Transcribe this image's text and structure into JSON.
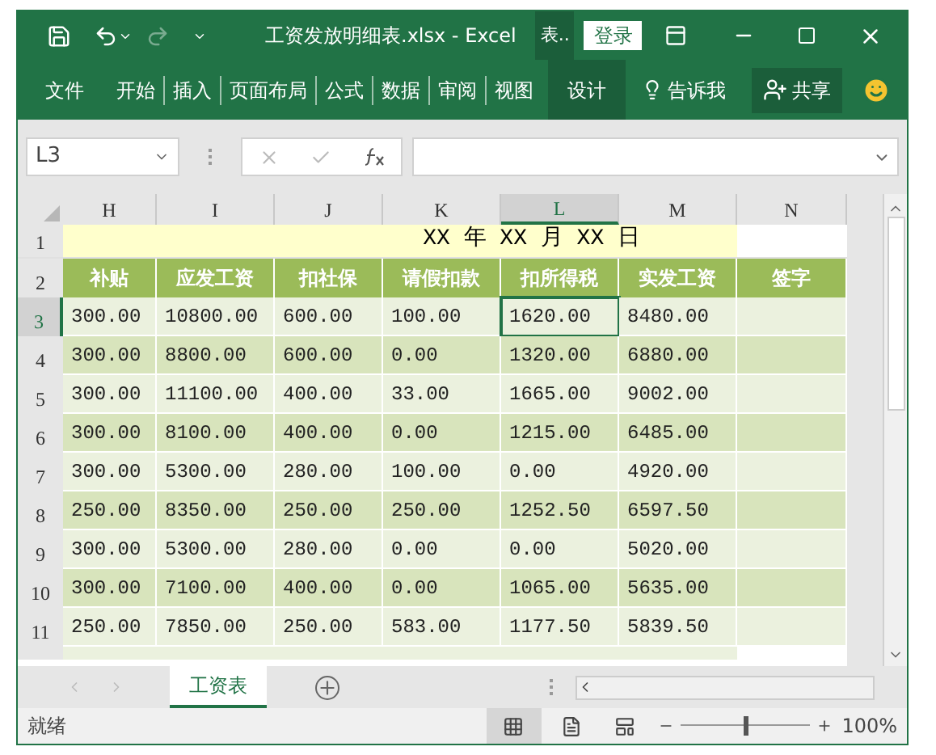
{
  "window": {
    "title": "工资发放明细表.xlsx - Excel",
    "context_tab": "表..",
    "login": "登录"
  },
  "ribbon": {
    "tabs": [
      {
        "label": "文件",
        "selected": false
      },
      {
        "label": "开始",
        "selected": false
      },
      {
        "label": "插入",
        "selected": false
      },
      {
        "label": "页面布局",
        "selected": false
      },
      {
        "label": "公式",
        "selected": false
      },
      {
        "label": "数据",
        "selected": false
      },
      {
        "label": "审阅",
        "selected": false
      },
      {
        "label": "视图",
        "selected": false
      },
      {
        "label": "设计",
        "selected": true
      }
    ],
    "tell_me": "告诉我",
    "share": "共享"
  },
  "formula_bar": {
    "name_box": "L3"
  },
  "sheet": {
    "columns": [
      {
        "label": "H",
        "selected": false
      },
      {
        "label": "I",
        "selected": false
      },
      {
        "label": "J",
        "selected": false
      },
      {
        "label": "K",
        "selected": false
      },
      {
        "label": "L",
        "selected": true
      },
      {
        "label": "M",
        "selected": false
      },
      {
        "label": "N",
        "selected": false
      }
    ],
    "date_row": {
      "number": "1",
      "text": "XX 年 XX 月 XX 日"
    },
    "header_row": {
      "number": "2",
      "cells": [
        "补贴",
        "应发工资",
        "扣社保",
        "请假扣款",
        "扣所得税",
        "实发工资",
        "签字"
      ]
    },
    "rows": [
      {
        "number": "3",
        "selected": true,
        "cells": [
          "300.00",
          "10800.00",
          "600.00",
          "100.00",
          "1620.00",
          "8480.00",
          ""
        ]
      },
      {
        "number": "4",
        "selected": false,
        "cells": [
          "300.00",
          "8800.00",
          "600.00",
          "0.00",
          "1320.00",
          "6880.00",
          ""
        ]
      },
      {
        "number": "5",
        "selected": false,
        "cells": [
          "300.00",
          "11100.00",
          "400.00",
          "33.00",
          "1665.00",
          "9002.00",
          ""
        ]
      },
      {
        "number": "6",
        "selected": false,
        "cells": [
          "300.00",
          "8100.00",
          "400.00",
          "0.00",
          "1215.00",
          "6485.00",
          ""
        ]
      },
      {
        "number": "7",
        "selected": false,
        "cells": [
          "300.00",
          "5300.00",
          "280.00",
          "100.00",
          "0.00",
          "4920.00",
          ""
        ]
      },
      {
        "number": "8",
        "selected": false,
        "cells": [
          "250.00",
          "8350.00",
          "250.00",
          "250.00",
          "1252.50",
          "6597.50",
          ""
        ]
      },
      {
        "number": "9",
        "selected": false,
        "cells": [
          "300.00",
          "5300.00",
          "280.00",
          "0.00",
          "0.00",
          "5020.00",
          ""
        ]
      },
      {
        "number": "10",
        "selected": false,
        "cells": [
          "300.00",
          "7100.00",
          "400.00",
          "0.00",
          "1065.00",
          "5635.00",
          ""
        ]
      },
      {
        "number": "11",
        "selected": false,
        "cells": [
          "250.00",
          "7850.00",
          "250.00",
          "583.00",
          "1177.50",
          "5839.50",
          ""
        ]
      }
    ]
  },
  "sheet_tabs": [
    {
      "label": "工资表",
      "selected": true
    }
  ],
  "status_bar": {
    "text": "就绪",
    "zoom": "100%",
    "level": 0.5
  }
}
